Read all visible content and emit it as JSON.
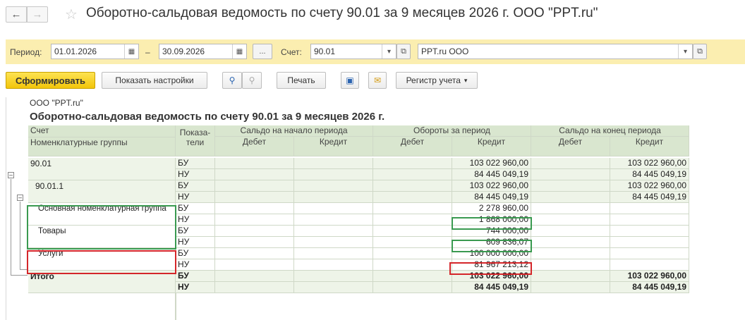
{
  "window": {
    "title": "Оборотно-сальдовая ведомость по счету 90.01 за 9 месяцев 2026 г. ООО \"PPT.ru\""
  },
  "filters": {
    "period_label": "Период:",
    "date_from": "01.01.2026",
    "dash": "–",
    "date_to": "30.09.2026",
    "dots": "...",
    "account_label": "Счет:",
    "account": "90.01",
    "organization": "PPT.ru ООО"
  },
  "toolbar": {
    "generate": "Сформировать",
    "show_settings": "Показать настройки",
    "print": "Печать",
    "register": "Регистр учета"
  },
  "report": {
    "organization": "ООО \"PPT.ru\"",
    "title": "Оборотно-сальдовая ведомость по счету 90.01 за 9 месяцев 2026 г.",
    "header": {
      "account": "Счет",
      "groups": "Номенклатурные группы",
      "indicators_1": "Показа-",
      "indicators_2": "тели",
      "opening": "Сальдо на начало периода",
      "turnover": "Обороты за период",
      "closing": "Сальдо на конец периода",
      "debit": "Дебет",
      "credit": "Кредит"
    },
    "rows": [
      {
        "name": "90.01",
        "ind": [
          "БУ",
          "НУ"
        ],
        "turnover_credit": [
          "103 022 960,00",
          "84 445 049,19"
        ],
        "closing_credit": [
          "103 022 960,00",
          "84 445 049,19"
        ]
      },
      {
        "name": "90.01.1",
        "ind": [
          "БУ",
          "НУ"
        ],
        "turnover_credit": [
          "103 022 960,00",
          "84 445 049,19"
        ],
        "closing_credit": [
          "103 022 960,00",
          "84 445 049,19"
        ]
      },
      {
        "name": "Основная номенклатурная группа",
        "ind": [
          "БУ",
          "НУ"
        ],
        "turnover_credit": [
          "2 278 960,00",
          "1 868 000,00"
        ],
        "closing_credit": [
          "",
          ""
        ]
      },
      {
        "name": "Товары",
        "ind": [
          "БУ",
          "НУ"
        ],
        "turnover_credit": [
          "744 000,00",
          "609 836,07"
        ],
        "closing_credit": [
          "",
          ""
        ]
      },
      {
        "name": "Услуги",
        "ind": [
          "БУ",
          "НУ"
        ],
        "turnover_credit": [
          "100 000 000,00",
          "81 967 213,12"
        ],
        "closing_credit": [
          "",
          ""
        ]
      }
    ],
    "total": {
      "name": "Итого",
      "ind": [
        "БУ",
        "НУ"
      ],
      "turnover_credit": [
        "103 022 960,00",
        "84 445 049,19"
      ],
      "closing_credit": [
        "103 022 960,00",
        "84 445 049,19"
      ]
    }
  }
}
